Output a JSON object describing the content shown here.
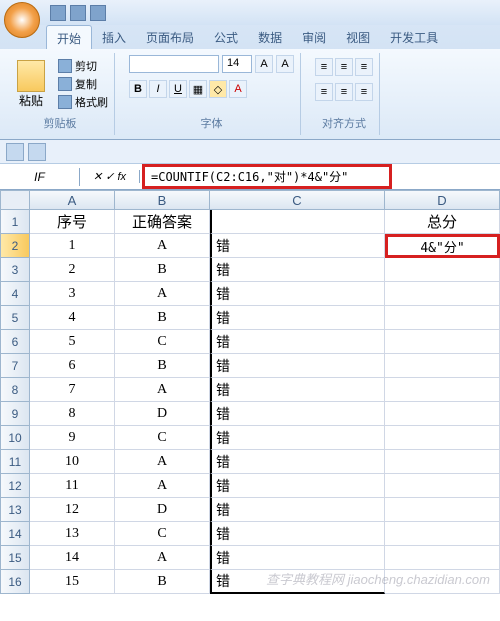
{
  "tabs": [
    "开始",
    "插入",
    "页面布局",
    "公式",
    "数据",
    "审阅",
    "视图",
    "开发工具"
  ],
  "active_tab": 0,
  "clipboard": {
    "paste": "粘贴",
    "cut": "剪切",
    "copy": "复制",
    "format_painter": "格式刷",
    "group": "剪贴板"
  },
  "font": {
    "size": "14",
    "bold": "B",
    "italic": "I",
    "underline": "U",
    "group": "字体"
  },
  "align_group": "对齐方式",
  "name_box": "IF",
  "fx_cancel": "✕",
  "fx_enter": "✓",
  "fx": "fx",
  "formula": "=COUNTIF(C2:C16,\"对\")*4&\"分\"",
  "columns": [
    "A",
    "B",
    "C",
    "D"
  ],
  "headers": {
    "A": "序号",
    "B": "正确答案",
    "C": "",
    "D": "总分"
  },
  "D2_display": "4&\"分\"",
  "rows": [
    {
      "n": "1",
      "A": "1",
      "B": "A",
      "C": "错"
    },
    {
      "n": "2",
      "A": "2",
      "B": "B",
      "C": "错"
    },
    {
      "n": "3",
      "A": "3",
      "B": "A",
      "C": "错"
    },
    {
      "n": "4",
      "A": "4",
      "B": "B",
      "C": "错"
    },
    {
      "n": "5",
      "A": "5",
      "B": "C",
      "C": "错"
    },
    {
      "n": "6",
      "A": "6",
      "B": "B",
      "C": "错"
    },
    {
      "n": "7",
      "A": "7",
      "B": "A",
      "C": "错"
    },
    {
      "n": "8",
      "A": "8",
      "B": "D",
      "C": "错"
    },
    {
      "n": "9",
      "A": "9",
      "B": "C",
      "C": "错"
    },
    {
      "n": "10",
      "A": "10",
      "B": "A",
      "C": "错"
    },
    {
      "n": "11",
      "A": "11",
      "B": "A",
      "C": "错"
    },
    {
      "n": "12",
      "A": "12",
      "B": "D",
      "C": "错"
    },
    {
      "n": "13",
      "A": "13",
      "B": "C",
      "C": "错"
    },
    {
      "n": "14",
      "A": "14",
      "B": "A",
      "C": "错"
    },
    {
      "n": "15",
      "A": "15",
      "B": "B",
      "C": "错"
    }
  ],
  "watermark": "查字典教程网 jiaocheng.chazidian.com"
}
